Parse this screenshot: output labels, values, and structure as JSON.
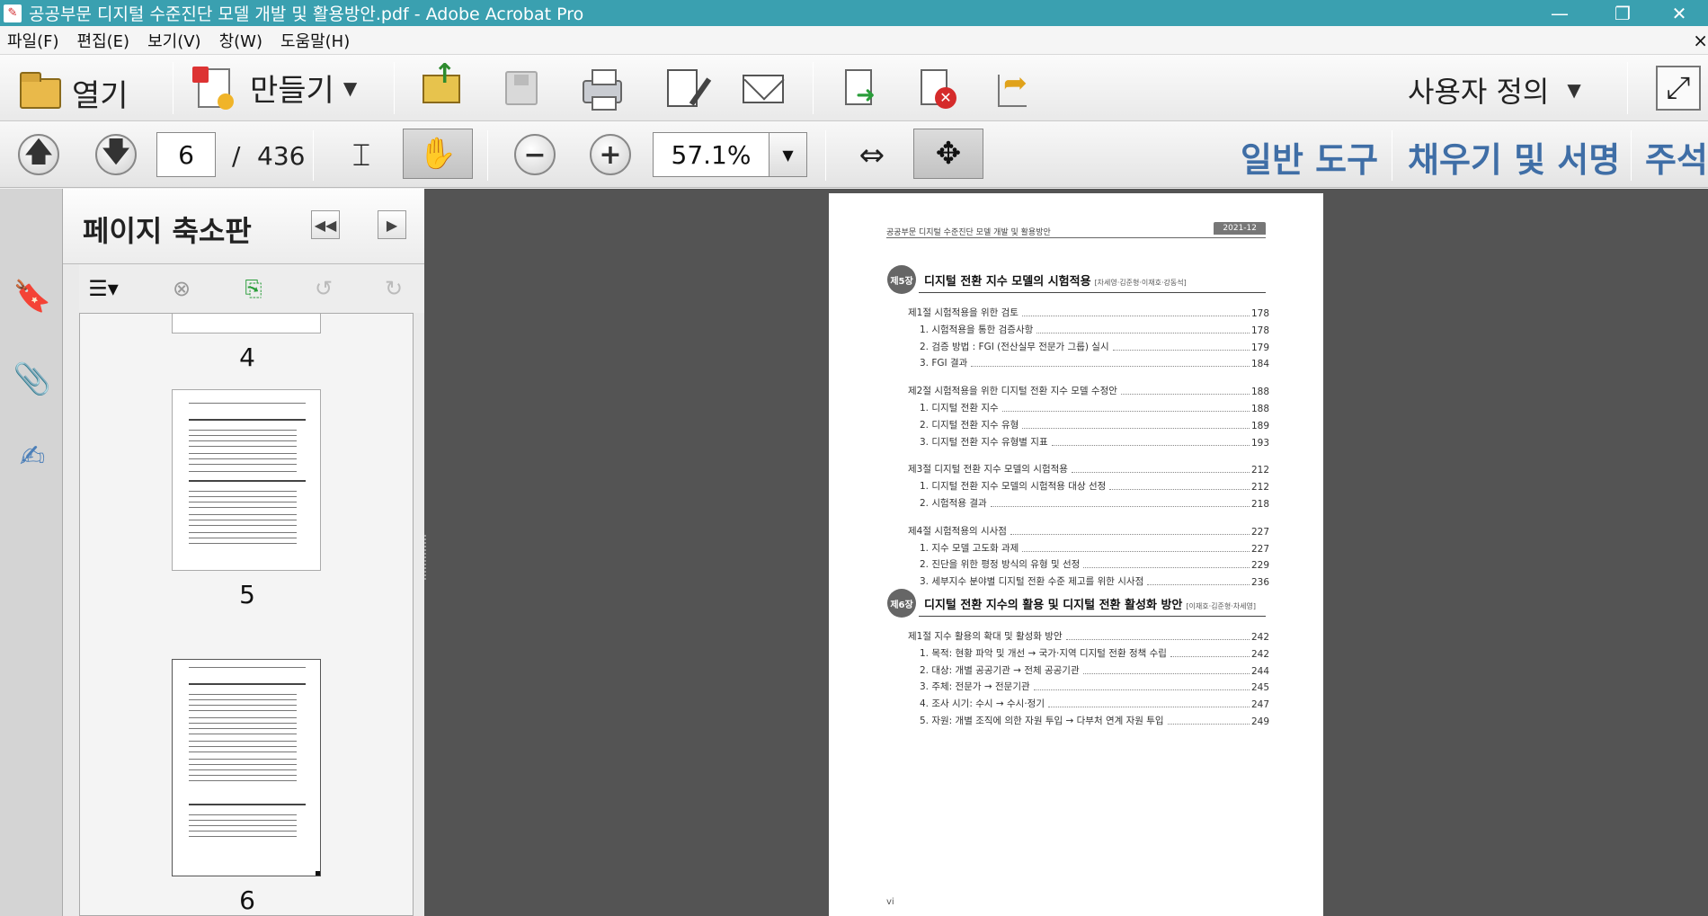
{
  "window": {
    "title": "공공부문 디지털 수준진단 모델 개발 및 활용방안.pdf - Adobe Acrobat Pro",
    "minimize": "—",
    "restore": "❐",
    "close": "✕"
  },
  "menu": {
    "items": [
      "파일(F)",
      "편집(E)",
      "보기(V)",
      "창(W)",
      "도움말(H)"
    ],
    "close_glyph": "×"
  },
  "toolbar": {
    "open_label": "열기",
    "create_label": "만들기",
    "customize_label": "사용자 정의"
  },
  "nav": {
    "current_page": "6",
    "page_separator": "/",
    "total_pages": "436",
    "zoom": "57.1%"
  },
  "panes": {
    "tools": "일반 도구",
    "fill_sign": "채우기 및 서명",
    "comment": "주석"
  },
  "thumbnails": {
    "panel_title": "페이지 축소판",
    "page_labels": [
      "4",
      "5",
      "6"
    ]
  },
  "document": {
    "header_left": "공공부문 디지털 수준진단 모델 개발 및 활용방안",
    "header_right": "2021-12",
    "footer": "vi",
    "chapters": [
      {
        "badge": "제5장",
        "title": "디지털 전환 지수 모델의 시험적용",
        "authors": "[차세영·김준형·이재호·강동석]",
        "sections": [
          {
            "label": "제1절 시험적용을 위한 검토",
            "page": "178",
            "items": [
              {
                "label": "1. 시험적용을 통한 검증사항",
                "page": "178"
              },
              {
                "label": "2. 검증 방법 : FGI (전산실무 전문가 그룹) 실시",
                "page": "179"
              },
              {
                "label": "3. FGI 결과",
                "page": "184"
              }
            ]
          },
          {
            "label": "제2절 시험적용을 위한 디지털 전환 지수 모델 수정안",
            "page": "188",
            "items": [
              {
                "label": "1. 디지털 전환 지수",
                "page": "188"
              },
              {
                "label": "2. 디지털 전환 지수 유형",
                "page": "189"
              },
              {
                "label": "3. 디지털 전환 지수 유형별 지표",
                "page": "193"
              }
            ]
          },
          {
            "label": "제3절 디지털 전환 지수 모델의 시험적용",
            "page": "212",
            "items": [
              {
                "label": "1. 디지털 전환 지수 모델의 시험적용 대상 선정",
                "page": "212"
              },
              {
                "label": "2. 시험적용 결과",
                "page": "218"
              }
            ]
          },
          {
            "label": "제4절 시험적용의 시사점",
            "page": "227",
            "items": [
              {
                "label": "1. 지수 모델 고도화 과제",
                "page": "227"
              },
              {
                "label": "2. 진단을 위한 평정 방식의 유형 및 선정",
                "page": "229"
              },
              {
                "label": "3. 세부지수 분야별 디지털 전환 수준 제고를 위한 시사점",
                "page": "236"
              }
            ]
          }
        ]
      },
      {
        "badge": "제6장",
        "title": "디지털 전환 지수의 활용 및 디지털 전환 활성화 방안",
        "authors": "[이재호·김준형·차세영]",
        "sections": [
          {
            "label": "제1절 지수 활용의 확대 및 활성화 방안",
            "page": "242",
            "items": [
              {
                "label": "1. 목적: 현황 파악 및 개선 → 국가·지역 디지털 전환 정책 수립",
                "page": "242"
              },
              {
                "label": "2. 대상: 개별 공공기관 → 전체 공공기관",
                "page": "244"
              },
              {
                "label": "3. 주체: 전문가 → 전문기관",
                "page": "245"
              },
              {
                "label": "4. 조사 시기: 수시 → 수시·정기",
                "page": "247"
              },
              {
                "label": "5. 자원: 개별 조직에 의한 자원 투입 → 다부처 연계 자원 투입",
                "page": "249"
              }
            ]
          }
        ]
      }
    ]
  },
  "colors": {
    "titlebar": "#3aa0b0",
    "pane_label": "#3f6ea6",
    "doc_background": "#545454"
  }
}
